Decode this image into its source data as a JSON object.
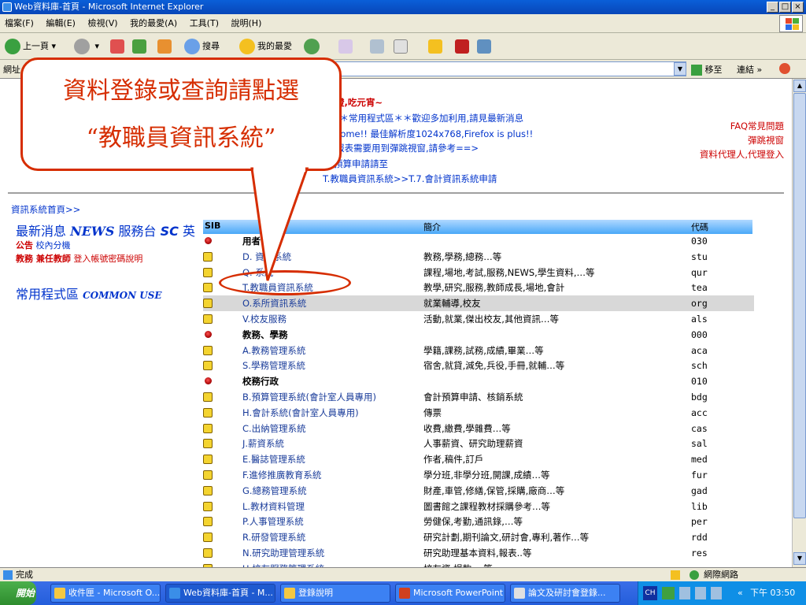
{
  "window": {
    "title": "Web資料庫-首頁 - Microsoft Internet Explorer",
    "min": "_",
    "max": "□",
    "close": "×"
  },
  "menu": [
    "檔案(F)",
    "編輯(E)",
    "檢視(V)",
    "我的最愛(A)",
    "工具(T)",
    "說明(H)"
  ],
  "toolbar": {
    "back": "上一頁",
    "search": "搜尋",
    "favorites": "我的最愛"
  },
  "address": {
    "label": "網址",
    "go": "移至",
    "links": "連結"
  },
  "header": {
    "line1": "燈,吃元宵~",
    "line2": "＊＊常用程式區＊＊歡迎多加利用,請見最新消息",
    "line3": "come!! 最佳解析度1024x768,Firefox is plus!!",
    "line4": "報表需要用到彈跳視窗,請參考==>",
    "line5": "預算申請請至",
    "line6": "T.教職員資訊系統>>T.7.會計資訊系統申請",
    "right1": "FAQ常見問題",
    "right2": "彈跳視窗",
    "right3": "資料代理人,代理登入"
  },
  "left": {
    "home": "資訊系統首頁>>",
    "news": "最新消息",
    "news_en": "NEWS",
    "service": "服務台",
    "service_en": "SC",
    "eng": "英",
    "ann_label": "公告",
    "ann_text": "校內分機",
    "teach_label": "教務 兼任教師",
    "teach_text": "登入帳號密碼說明",
    "common": "常用程式區",
    "common_en": "COMMON USE"
  },
  "table": {
    "head_sib": "SIB",
    "head_desc": "簡介",
    "head_code": "代碼",
    "rows": [
      {
        "type": "dot",
        "name": "用者",
        "bold": true,
        "desc": "",
        "code": "030"
      },
      {
        "type": "fold",
        "name": "D.    資訊系統",
        "desc": "教務,學務,總務…等",
        "code": "stu"
      },
      {
        "type": "fold",
        "name": "Q.    系統",
        "desc": "課程,場地,考試,服務,NEWS,學生資料,…等",
        "code": "qur"
      },
      {
        "type": "fold",
        "name": "T.教職員資訊系統",
        "desc": "教學,研究,服務,教師成長,場地,會計",
        "code": "tea"
      },
      {
        "type": "fold",
        "name": "O.系所資訊系統",
        "desc": "就業輔導,校友",
        "code": "org",
        "hl": true
      },
      {
        "type": "fold",
        "name": "V.校友服務",
        "desc": "活動,就業,傑出校友,其他資訊…等",
        "code": "als"
      },
      {
        "type": "dot",
        "name": "教務、學務",
        "bold": true,
        "desc": "",
        "code": "000"
      },
      {
        "type": "fold",
        "name": "A.教務管理系統",
        "desc": "學籍,課務,試務,成績,畢業…等",
        "code": "aca"
      },
      {
        "type": "fold",
        "name": "S.學務管理系統",
        "desc": "宿舍,就貸,減免,兵役,手冊,就輔…等",
        "code": "sch"
      },
      {
        "type": "dot",
        "name": "校務行政",
        "bold": true,
        "desc": "",
        "code": "010"
      },
      {
        "type": "fold",
        "name": "B.預算管理系統(會計室人員專用)",
        "desc": "會計預算申請、核銷系統",
        "code": "bdg"
      },
      {
        "type": "fold",
        "name": "H.會計系統(會計室人員專用)",
        "desc": "傳票",
        "code": "acc"
      },
      {
        "type": "fold",
        "name": "C.出納管理系統",
        "desc": "收費,繳費,學雜費…等",
        "code": "cas"
      },
      {
        "type": "fold",
        "name": "J.薪資系統",
        "desc": "人事薪資、研究助理薪資",
        "code": "sal"
      },
      {
        "type": "fold",
        "name": "E.醫誌管理系統",
        "desc": "作者,稿件,訂戶",
        "code": "med"
      },
      {
        "type": "fold",
        "name": "F.進修推廣教育系統",
        "desc": "學分班,非學分班,開課,成績…等",
        "code": "fur"
      },
      {
        "type": "fold",
        "name": "G.總務管理系統",
        "desc": "財產,車管,修繕,保管,採購,廠商…等",
        "code": "gad"
      },
      {
        "type": "fold",
        "name": "L.教材資料管理",
        "desc": "圖書館之課程教材採購參考…等",
        "code": "lib"
      },
      {
        "type": "fold",
        "name": "P.人事管理系統",
        "desc": "勞健保,考勤,通訊錄,…等",
        "code": "per"
      },
      {
        "type": "fold",
        "name": "R.研發管理系統",
        "desc": "研究計劃,期刊論文,研討會,專利,著作…等",
        "code": "rdd"
      },
      {
        "type": "fold",
        "name": "N.研究助理管理系統",
        "desc": "研究助理基本資料,報表..等",
        "code": "res"
      },
      {
        "type": "fold",
        "name": "U.校友服務管理系統",
        "desc": "校友資,捐款,…等",
        "code": ""
      }
    ]
  },
  "callout": {
    "line1": "資料登錄或查詢請點選",
    "line2": "“教職員資訊系統”"
  },
  "status": {
    "done": "完成",
    "zone": "網際網路"
  },
  "taskbar": {
    "start": "開始",
    "tasks": [
      "收件匣 - Microsoft O...",
      "Web資料庫-首頁 - M...",
      "登錄說明",
      "Microsoft PowerPoint ...",
      "論文及研討會登錄..."
    ],
    "ime": "CH",
    "clock": "下午 03:50"
  }
}
